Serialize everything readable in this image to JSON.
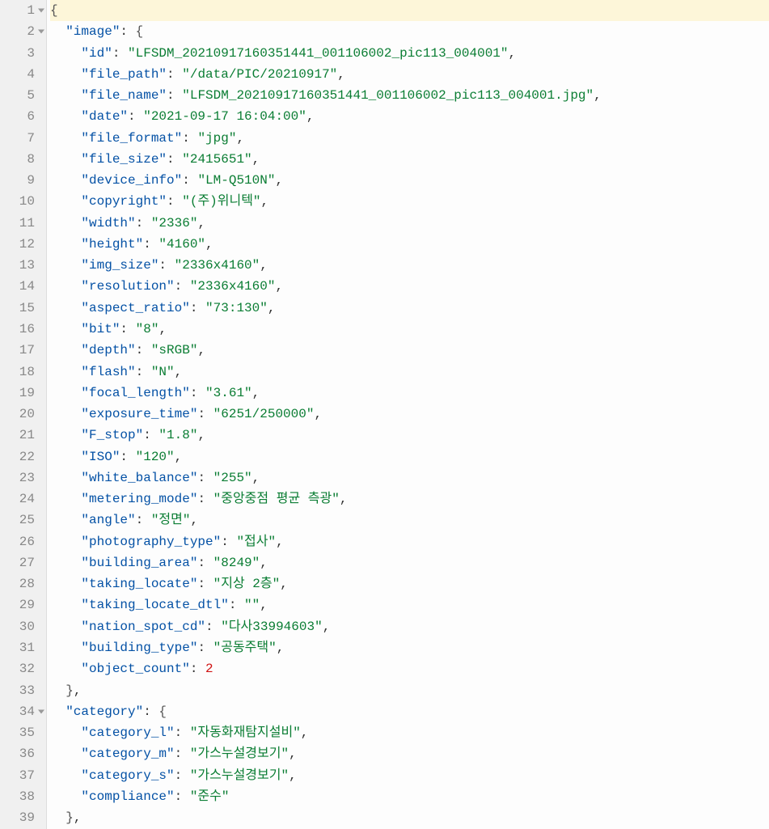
{
  "lines": [
    {
      "n": 1,
      "fold": true,
      "hl": true,
      "ind": 0,
      "tokens": [
        {
          "t": "brace",
          "v": "{"
        }
      ]
    },
    {
      "n": 2,
      "fold": true,
      "ind": 1,
      "tokens": [
        {
          "t": "key",
          "v": "\"image\""
        },
        {
          "t": "pun",
          "v": ": "
        },
        {
          "t": "brace",
          "v": "{"
        }
      ]
    },
    {
      "n": 3,
      "ind": 2,
      "tokens": [
        {
          "t": "key",
          "v": "\"id\""
        },
        {
          "t": "pun",
          "v": ": "
        },
        {
          "t": "str",
          "v": "\"LFSDM_20210917160351441_001106002_pic113_004001\""
        },
        {
          "t": "pun",
          "v": ","
        }
      ]
    },
    {
      "n": 4,
      "ind": 2,
      "tokens": [
        {
          "t": "key",
          "v": "\"file_path\""
        },
        {
          "t": "pun",
          "v": ": "
        },
        {
          "t": "str",
          "v": "\"/data/PIC/20210917\""
        },
        {
          "t": "pun",
          "v": ","
        }
      ]
    },
    {
      "n": 5,
      "ind": 2,
      "tokens": [
        {
          "t": "key",
          "v": "\"file_name\""
        },
        {
          "t": "pun",
          "v": ": "
        },
        {
          "t": "str",
          "v": "\"LFSDM_20210917160351441_001106002_pic113_004001.jpg\""
        },
        {
          "t": "pun",
          "v": ","
        }
      ]
    },
    {
      "n": 6,
      "ind": 2,
      "tokens": [
        {
          "t": "key",
          "v": "\"date\""
        },
        {
          "t": "pun",
          "v": ": "
        },
        {
          "t": "str",
          "v": "\"2021-09-17 16:04:00\""
        },
        {
          "t": "pun",
          "v": ","
        }
      ]
    },
    {
      "n": 7,
      "ind": 2,
      "tokens": [
        {
          "t": "key",
          "v": "\"file_format\""
        },
        {
          "t": "pun",
          "v": ": "
        },
        {
          "t": "str",
          "v": "\"jpg\""
        },
        {
          "t": "pun",
          "v": ","
        }
      ]
    },
    {
      "n": 8,
      "ind": 2,
      "tokens": [
        {
          "t": "key",
          "v": "\"file_size\""
        },
        {
          "t": "pun",
          "v": ": "
        },
        {
          "t": "str",
          "v": "\"2415651\""
        },
        {
          "t": "pun",
          "v": ","
        }
      ]
    },
    {
      "n": 9,
      "ind": 2,
      "tokens": [
        {
          "t": "key",
          "v": "\"device_info\""
        },
        {
          "t": "pun",
          "v": ": "
        },
        {
          "t": "str",
          "v": "\"LM-Q510N\""
        },
        {
          "t": "pun",
          "v": ","
        }
      ]
    },
    {
      "n": 10,
      "ind": 2,
      "tokens": [
        {
          "t": "key",
          "v": "\"copyright\""
        },
        {
          "t": "pun",
          "v": ": "
        },
        {
          "t": "str",
          "v": "\"(주)위니텍\""
        },
        {
          "t": "pun",
          "v": ","
        }
      ]
    },
    {
      "n": 11,
      "ind": 2,
      "tokens": [
        {
          "t": "key",
          "v": "\"width\""
        },
        {
          "t": "pun",
          "v": ": "
        },
        {
          "t": "str",
          "v": "\"2336\""
        },
        {
          "t": "pun",
          "v": ","
        }
      ]
    },
    {
      "n": 12,
      "ind": 2,
      "tokens": [
        {
          "t": "key",
          "v": "\"height\""
        },
        {
          "t": "pun",
          "v": ": "
        },
        {
          "t": "str",
          "v": "\"4160\""
        },
        {
          "t": "pun",
          "v": ","
        }
      ]
    },
    {
      "n": 13,
      "ind": 2,
      "tokens": [
        {
          "t": "key",
          "v": "\"img_size\""
        },
        {
          "t": "pun",
          "v": ": "
        },
        {
          "t": "str",
          "v": "\"2336x4160\""
        },
        {
          "t": "pun",
          "v": ","
        }
      ]
    },
    {
      "n": 14,
      "ind": 2,
      "tokens": [
        {
          "t": "key",
          "v": "\"resolution\""
        },
        {
          "t": "pun",
          "v": ": "
        },
        {
          "t": "str",
          "v": "\"2336x4160\""
        },
        {
          "t": "pun",
          "v": ","
        }
      ]
    },
    {
      "n": 15,
      "ind": 2,
      "tokens": [
        {
          "t": "key",
          "v": "\"aspect_ratio\""
        },
        {
          "t": "pun",
          "v": ": "
        },
        {
          "t": "str",
          "v": "\"73:130\""
        },
        {
          "t": "pun",
          "v": ","
        }
      ]
    },
    {
      "n": 16,
      "ind": 2,
      "tokens": [
        {
          "t": "key",
          "v": "\"bit\""
        },
        {
          "t": "pun",
          "v": ": "
        },
        {
          "t": "str",
          "v": "\"8\""
        },
        {
          "t": "pun",
          "v": ","
        }
      ]
    },
    {
      "n": 17,
      "ind": 2,
      "tokens": [
        {
          "t": "key",
          "v": "\"depth\""
        },
        {
          "t": "pun",
          "v": ": "
        },
        {
          "t": "str",
          "v": "\"sRGB\""
        },
        {
          "t": "pun",
          "v": ","
        }
      ]
    },
    {
      "n": 18,
      "ind": 2,
      "tokens": [
        {
          "t": "key",
          "v": "\"flash\""
        },
        {
          "t": "pun",
          "v": ": "
        },
        {
          "t": "str",
          "v": "\"N\""
        },
        {
          "t": "pun",
          "v": ","
        }
      ]
    },
    {
      "n": 19,
      "ind": 2,
      "tokens": [
        {
          "t": "key",
          "v": "\"focal_length\""
        },
        {
          "t": "pun",
          "v": ": "
        },
        {
          "t": "str",
          "v": "\"3.61\""
        },
        {
          "t": "pun",
          "v": ","
        }
      ]
    },
    {
      "n": 20,
      "ind": 2,
      "tokens": [
        {
          "t": "key",
          "v": "\"exposure_time\""
        },
        {
          "t": "pun",
          "v": ": "
        },
        {
          "t": "str",
          "v": "\"6251/250000\""
        },
        {
          "t": "pun",
          "v": ","
        }
      ]
    },
    {
      "n": 21,
      "ind": 2,
      "tokens": [
        {
          "t": "key",
          "v": "\"F_stop\""
        },
        {
          "t": "pun",
          "v": ": "
        },
        {
          "t": "str",
          "v": "\"1.8\""
        },
        {
          "t": "pun",
          "v": ","
        }
      ]
    },
    {
      "n": 22,
      "ind": 2,
      "tokens": [
        {
          "t": "key",
          "v": "\"ISO\""
        },
        {
          "t": "pun",
          "v": ": "
        },
        {
          "t": "str",
          "v": "\"120\""
        },
        {
          "t": "pun",
          "v": ","
        }
      ]
    },
    {
      "n": 23,
      "ind": 2,
      "tokens": [
        {
          "t": "key",
          "v": "\"white_balance\""
        },
        {
          "t": "pun",
          "v": ": "
        },
        {
          "t": "str",
          "v": "\"255\""
        },
        {
          "t": "pun",
          "v": ","
        }
      ]
    },
    {
      "n": 24,
      "ind": 2,
      "tokens": [
        {
          "t": "key",
          "v": "\"metering_mode\""
        },
        {
          "t": "pun",
          "v": ": "
        },
        {
          "t": "str",
          "v": "\"중앙중점 평균 측광\""
        },
        {
          "t": "pun",
          "v": ","
        }
      ]
    },
    {
      "n": 25,
      "ind": 2,
      "tokens": [
        {
          "t": "key",
          "v": "\"angle\""
        },
        {
          "t": "pun",
          "v": ": "
        },
        {
          "t": "str",
          "v": "\"정면\""
        },
        {
          "t": "pun",
          "v": ","
        }
      ]
    },
    {
      "n": 26,
      "ind": 2,
      "tokens": [
        {
          "t": "key",
          "v": "\"photography_type\""
        },
        {
          "t": "pun",
          "v": ": "
        },
        {
          "t": "str",
          "v": "\"접사\""
        },
        {
          "t": "pun",
          "v": ","
        }
      ]
    },
    {
      "n": 27,
      "ind": 2,
      "tokens": [
        {
          "t": "key",
          "v": "\"building_area\""
        },
        {
          "t": "pun",
          "v": ": "
        },
        {
          "t": "str",
          "v": "\"8249\""
        },
        {
          "t": "pun",
          "v": ","
        }
      ]
    },
    {
      "n": 28,
      "ind": 2,
      "tokens": [
        {
          "t": "key",
          "v": "\"taking_locate\""
        },
        {
          "t": "pun",
          "v": ": "
        },
        {
          "t": "str",
          "v": "\"지상 2층\""
        },
        {
          "t": "pun",
          "v": ","
        }
      ]
    },
    {
      "n": 29,
      "ind": 2,
      "tokens": [
        {
          "t": "key",
          "v": "\"taking_locate_dtl\""
        },
        {
          "t": "pun",
          "v": ": "
        },
        {
          "t": "str",
          "v": "\"\""
        },
        {
          "t": "pun",
          "v": ","
        }
      ]
    },
    {
      "n": 30,
      "ind": 2,
      "tokens": [
        {
          "t": "key",
          "v": "\"nation_spot_cd\""
        },
        {
          "t": "pun",
          "v": ": "
        },
        {
          "t": "str",
          "v": "\"다사33994603\""
        },
        {
          "t": "pun",
          "v": ","
        }
      ]
    },
    {
      "n": 31,
      "ind": 2,
      "tokens": [
        {
          "t": "key",
          "v": "\"building_type\""
        },
        {
          "t": "pun",
          "v": ": "
        },
        {
          "t": "str",
          "v": "\"공동주택\""
        },
        {
          "t": "pun",
          "v": ","
        }
      ]
    },
    {
      "n": 32,
      "ind": 2,
      "tokens": [
        {
          "t": "key",
          "v": "\"object_count\""
        },
        {
          "t": "pun",
          "v": ": "
        },
        {
          "t": "num",
          "v": "2"
        }
      ]
    },
    {
      "n": 33,
      "ind": 1,
      "tokens": [
        {
          "t": "brace",
          "v": "}"
        },
        {
          "t": "pun",
          "v": ","
        }
      ]
    },
    {
      "n": 34,
      "fold": true,
      "ind": 1,
      "tokens": [
        {
          "t": "key",
          "v": "\"category\""
        },
        {
          "t": "pun",
          "v": ": "
        },
        {
          "t": "brace",
          "v": "{"
        }
      ]
    },
    {
      "n": 35,
      "ind": 2,
      "tokens": [
        {
          "t": "key",
          "v": "\"category_l\""
        },
        {
          "t": "pun",
          "v": ": "
        },
        {
          "t": "str",
          "v": "\"자동화재탐지설비\""
        },
        {
          "t": "pun",
          "v": ","
        }
      ]
    },
    {
      "n": 36,
      "ind": 2,
      "tokens": [
        {
          "t": "key",
          "v": "\"category_m\""
        },
        {
          "t": "pun",
          "v": ": "
        },
        {
          "t": "str",
          "v": "\"가스누설경보기\""
        },
        {
          "t": "pun",
          "v": ","
        }
      ]
    },
    {
      "n": 37,
      "ind": 2,
      "tokens": [
        {
          "t": "key",
          "v": "\"category_s\""
        },
        {
          "t": "pun",
          "v": ": "
        },
        {
          "t": "str",
          "v": "\"가스누설경보기\""
        },
        {
          "t": "pun",
          "v": ","
        }
      ]
    },
    {
      "n": 38,
      "ind": 2,
      "tokens": [
        {
          "t": "key",
          "v": "\"compliance\""
        },
        {
          "t": "pun",
          "v": ": "
        },
        {
          "t": "str",
          "v": "\"준수\""
        }
      ]
    },
    {
      "n": 39,
      "ind": 1,
      "tokens": [
        {
          "t": "brace",
          "v": "}"
        },
        {
          "t": "pun",
          "v": ","
        }
      ]
    }
  ]
}
